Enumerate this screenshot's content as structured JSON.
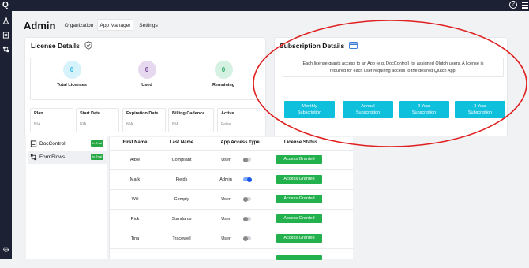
{
  "header": {
    "logo": "Q",
    "help": "?",
    "title": "Admin"
  },
  "tabs": [
    {
      "label": "Organization",
      "active": false
    },
    {
      "label": "App Manager",
      "active": true
    },
    {
      "label": "Settings",
      "active": false
    }
  ],
  "license": {
    "title": "License Details",
    "stats": [
      {
        "value": "0",
        "label": "Total Licenses",
        "color": "#6dcff6",
        "bg": "#d6f2fb"
      },
      {
        "value": "0",
        "label": "Used",
        "color": "#8a55a8",
        "bg": "#e6d9ef"
      },
      {
        "value": "0",
        "label": "Remaining",
        "color": "#5cc98c",
        "bg": "#d4f1e1"
      }
    ],
    "fields": [
      {
        "label": "Plan",
        "value": "N/A"
      },
      {
        "label": "Start Date",
        "value": "N/A"
      },
      {
        "label": "Expiration Date",
        "value": "N/A"
      },
      {
        "label": "Billing Cadence",
        "value": "N/A"
      },
      {
        "label": "Active",
        "value": "False"
      }
    ]
  },
  "subscription": {
    "title": "Subscription Details",
    "description_line1": "Each license grants access to an App (e.g. DocControl) for assigned Qlutch users. A license is",
    "description_line2": "required for each user requiring access to the desired Qlutch App.",
    "buttons": [
      {
        "line1": "Monthly",
        "line2": "Subscription"
      },
      {
        "line1": "Annual",
        "line2": "Subscription"
      },
      {
        "line1": "2 Year",
        "line2": "Subscription"
      },
      {
        "line1": "3 Year",
        "line2": "Subscription"
      }
    ]
  },
  "apps": [
    {
      "name": "DocControl",
      "badge": "In Trial"
    },
    {
      "name": "FormFlows",
      "badge": "In Trial"
    }
  ],
  "table": {
    "headers": [
      "First Name",
      "Last Name",
      "App Access Type",
      "License Status"
    ],
    "rows": [
      {
        "first": "Albie",
        "last": "Compliant",
        "type": "User",
        "on": false,
        "status": "Access Granted"
      },
      {
        "first": "Mark",
        "last": "Fields",
        "type": "Admin",
        "on": true,
        "status": "Access Granted"
      },
      {
        "first": "Will",
        "last": "Comply",
        "type": "User",
        "on": false,
        "status": "Access Granted"
      },
      {
        "first": "Rick",
        "last": "Standards",
        "type": "User",
        "on": false,
        "status": "Access Granted"
      },
      {
        "first": "Tina",
        "last": "Tracewell",
        "type": "User",
        "on": false,
        "status": "Access Granted"
      }
    ]
  },
  "colors": {
    "accent": "#0fc0dc",
    "granted": "#22b14c",
    "annotation": "#e02020",
    "nav": "#1c2233"
  }
}
